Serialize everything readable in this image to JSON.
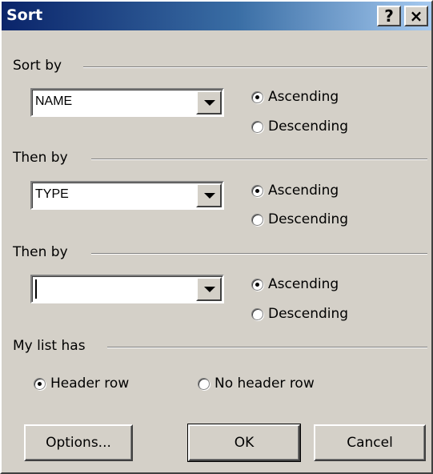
{
  "window": {
    "title": "Sort",
    "help_label": "?",
    "close_label": "×"
  },
  "sort_by": {
    "label": "Sort by",
    "value": "NAME",
    "ascending": "Ascending",
    "descending": "Descending",
    "selected": "ascending"
  },
  "then_by_1": {
    "label": "Then by",
    "value": "TYPE",
    "ascending": "Ascending",
    "descending": "Descending",
    "selected": "ascending"
  },
  "then_by_2": {
    "label": "Then by",
    "value": "",
    "ascending": "Ascending",
    "descending": "Descending",
    "selected": "ascending"
  },
  "list_has": {
    "label": "My list has",
    "header_row": "Header row",
    "no_header_row": "No header row",
    "selected": "header_row"
  },
  "buttons": {
    "options": "Options...",
    "ok": "OK",
    "cancel": "Cancel"
  }
}
